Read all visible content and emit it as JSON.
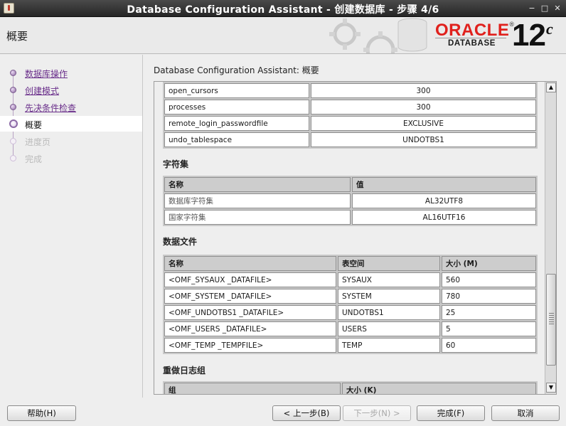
{
  "window": {
    "title": "Database Configuration Assistant - 创建数据库 - 步骤 4/6",
    "controls": [
      "−",
      "□",
      "✕"
    ]
  },
  "header": {
    "page_heading": "概要",
    "logo_oracle": "ORACLE",
    "logo_registered": "®",
    "logo_database": "DATABASE",
    "logo_version": "12",
    "logo_version_suffix": "c"
  },
  "nav": {
    "items": [
      {
        "label": "数据库操作",
        "state": "done"
      },
      {
        "label": "创建模式",
        "state": "done"
      },
      {
        "label": "先决条件检查",
        "state": "done"
      },
      {
        "label": "概要",
        "state": "current"
      },
      {
        "label": "进度页",
        "state": "disabled"
      },
      {
        "label": "完成",
        "state": "disabled"
      }
    ]
  },
  "content": {
    "heading": "Database Configuration Assistant: 概要",
    "params_rows": [
      [
        "open_cursors",
        "300"
      ],
      [
        "processes",
        "300"
      ],
      [
        "remote_login_passwordfile",
        "EXCLUSIVE"
      ],
      [
        "undo_tablespace",
        "UNDOTBS1"
      ]
    ],
    "charset": {
      "title": "字符集",
      "headers": [
        "名称",
        "值"
      ],
      "rows": [
        [
          "数据库字符集",
          "AL32UTF8"
        ],
        [
          "国家字符集",
          "AL16UTF16"
        ]
      ]
    },
    "datafiles": {
      "title": "数据文件",
      "headers": [
        "名称",
        "表空间",
        "大小 (M)"
      ],
      "rows": [
        [
          "<OMF_SYSAUX _DATAFILE>",
          "SYSAUX",
          "560"
        ],
        [
          "<OMF_SYSTEM _DATAFILE>",
          "SYSTEM",
          "780"
        ],
        [
          "<OMF_UNDOTBS1 _DATAFILE>",
          "UNDOTBS1",
          "25"
        ],
        [
          "<OMF_USERS _DATAFILE>",
          "USERS",
          "5"
        ],
        [
          "<OMF_TEMP _TEMPFILE>",
          "TEMP",
          "60"
        ]
      ]
    },
    "redo": {
      "title": "重做日志组",
      "headers": [
        "组",
        "大小 (K)"
      ]
    }
  },
  "buttons": {
    "help": "帮助(H)",
    "back": "< 上一步(B)",
    "next": "下一步(N) >",
    "finish": "完成(F)",
    "cancel": "取消"
  }
}
